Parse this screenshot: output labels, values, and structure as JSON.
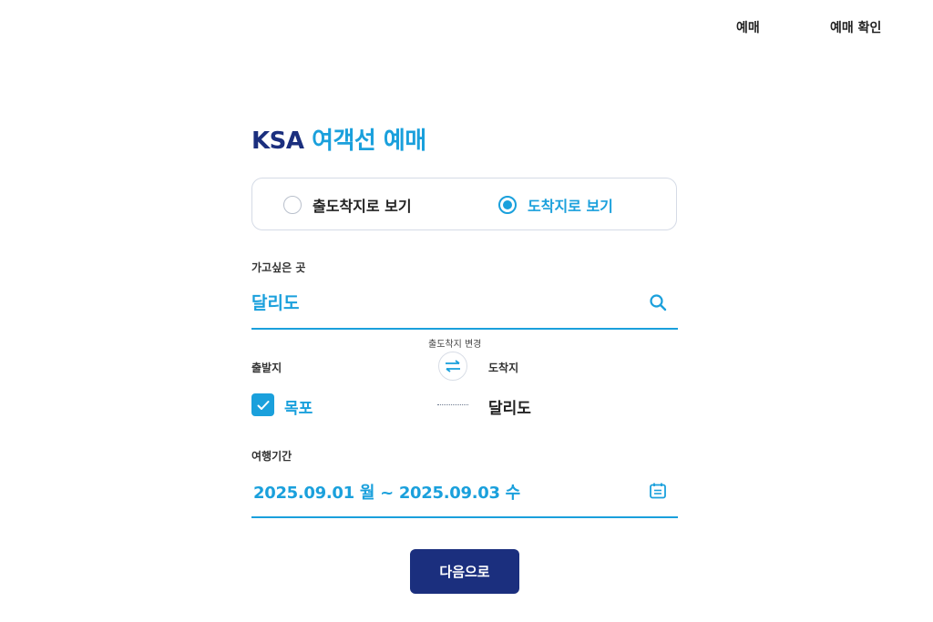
{
  "nav": {
    "booking": "예매",
    "booking_confirm": "예매 확인"
  },
  "title": {
    "brand": "KSA",
    "subtitle": "여객선 예매"
  },
  "view_mode": {
    "options": [
      {
        "label": "출도착지로 보기",
        "selected": false
      },
      {
        "label": "도착지로 보기",
        "selected": true
      }
    ]
  },
  "destination": {
    "label": "가고싶은 곳",
    "value": "달리도",
    "icon": "search-icon"
  },
  "route": {
    "swap_caption": "출도착지 변경",
    "origin_label": "출발지",
    "origin_value": "목포",
    "origin_checked": true,
    "arrival_label": "도착지",
    "arrival_value": "달리도"
  },
  "period": {
    "label": "여행기간",
    "value": "2025.09.01 월 ~ 2025.09.03 수",
    "icon": "calendar-icon"
  },
  "next_button": {
    "label": "다음으로"
  },
  "colors": {
    "accent": "#1aa0dc",
    "brand": "#1b2f7e",
    "text": "#222222",
    "border": "#d5dbe6"
  }
}
